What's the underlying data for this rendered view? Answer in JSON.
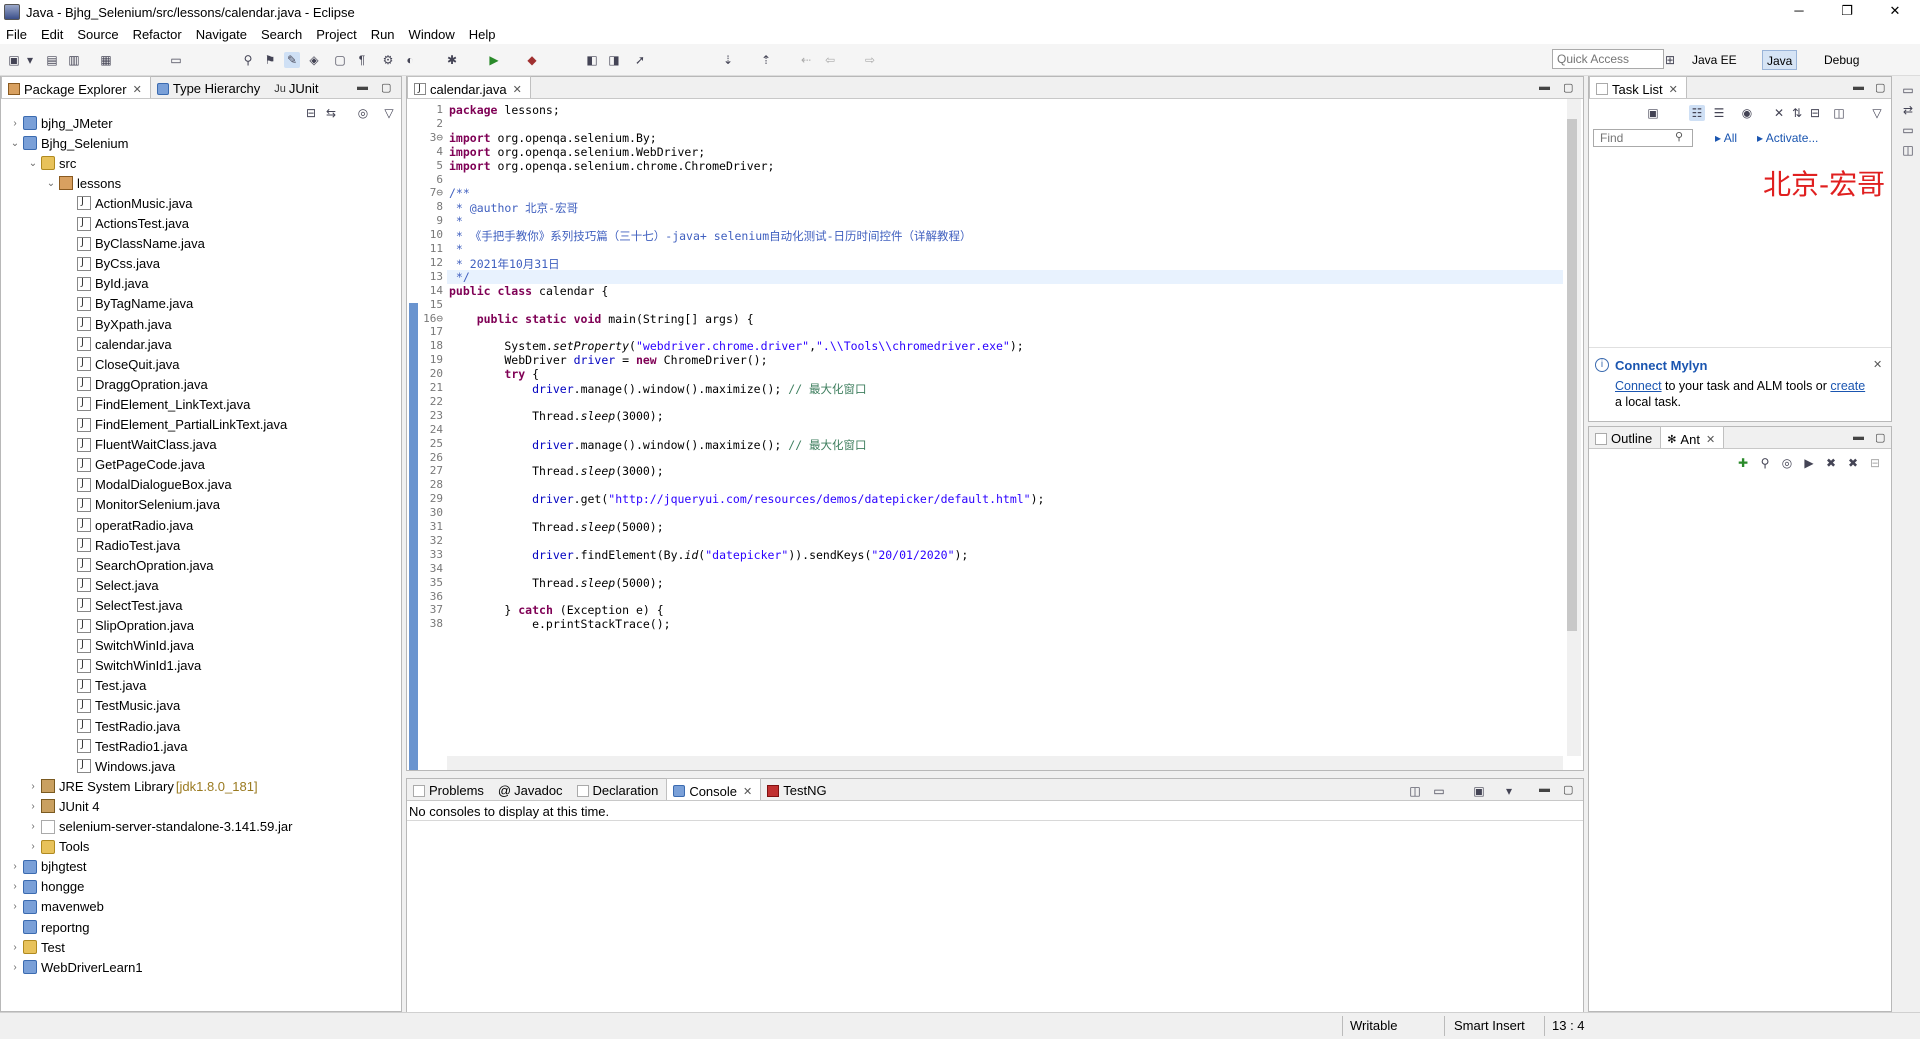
{
  "window": {
    "title": "Java - Bjhg_Selenium/src/lessons/calendar.java - Eclipse",
    "minimize": "─",
    "maximize": "❐",
    "close": "✕"
  },
  "menu": [
    "File",
    "Edit",
    "Source",
    "Refactor",
    "Navigate",
    "Search",
    "Project",
    "Run",
    "Window",
    "Help"
  ],
  "toolbar": {
    "quick_access_placeholder": "Quick Access",
    "perspectives": [
      "Java EE",
      "Java",
      "Debug"
    ],
    "active_perspective": "Java"
  },
  "left_panel": {
    "tabs": [
      "Package Explorer",
      "Type Hierarchy",
      "JUnit"
    ],
    "tree": [
      {
        "label": "bjhg_JMeter",
        "level": 0,
        "expanded": false,
        "icon": "project-icon"
      },
      {
        "label": "Bjhg_Selenium",
        "level": 0,
        "expanded": true,
        "icon": "project-icon"
      },
      {
        "label": "src",
        "level": 1,
        "expanded": true,
        "icon": "folder-icon"
      },
      {
        "label": "lessons",
        "level": 2,
        "expanded": true,
        "icon": "package-icon"
      },
      {
        "label": "ActionMusic.java",
        "level": 3,
        "icon": "java-file-icon"
      },
      {
        "label": "ActionsTest.java",
        "level": 3,
        "icon": "java-file-icon"
      },
      {
        "label": "ByClassName.java",
        "level": 3,
        "icon": "java-file-icon"
      },
      {
        "label": "ByCss.java",
        "level": 3,
        "icon": "java-file-icon"
      },
      {
        "label": "ById.java",
        "level": 3,
        "icon": "java-file-icon"
      },
      {
        "label": "ByTagName.java",
        "level": 3,
        "icon": "java-file-icon"
      },
      {
        "label": "ByXpath.java",
        "level": 3,
        "icon": "java-file-icon"
      },
      {
        "label": "calendar.java",
        "level": 3,
        "icon": "java-file-icon"
      },
      {
        "label": "CloseQuit.java",
        "level": 3,
        "icon": "java-file-icon"
      },
      {
        "label": "DraggOpration.java",
        "level": 3,
        "icon": "java-file-icon"
      },
      {
        "label": "FindElement_LinkText.java",
        "level": 3,
        "icon": "java-file-icon"
      },
      {
        "label": "FindElement_PartialLinkText.java",
        "level": 3,
        "icon": "java-file-icon"
      },
      {
        "label": "FluentWaitClass.java",
        "level": 3,
        "icon": "java-file-icon"
      },
      {
        "label": "GetPageCode.java",
        "level": 3,
        "icon": "java-file-icon"
      },
      {
        "label": "ModalDialogueBox.java",
        "level": 3,
        "icon": "java-file-icon"
      },
      {
        "label": "MonitorSelenium.java",
        "level": 3,
        "icon": "java-file-icon"
      },
      {
        "label": "operatRadio.java",
        "level": 3,
        "icon": "java-file-icon"
      },
      {
        "label": "RadioTest.java",
        "level": 3,
        "icon": "java-file-icon"
      },
      {
        "label": "SearchOpration.java",
        "level": 3,
        "icon": "java-file-icon"
      },
      {
        "label": "Select.java",
        "level": 3,
        "icon": "java-file-icon"
      },
      {
        "label": "SelectTest.java",
        "level": 3,
        "icon": "java-file-icon"
      },
      {
        "label": "SlipOpration.java",
        "level": 3,
        "icon": "java-file-icon"
      },
      {
        "label": "SwitchWinId.java",
        "level": 3,
        "icon": "java-file-icon"
      },
      {
        "label": "SwitchWinId1.java",
        "level": 3,
        "icon": "java-file-icon"
      },
      {
        "label": "Test.java",
        "level": 3,
        "icon": "java-file-icon"
      },
      {
        "label": "TestMusic.java",
        "level": 3,
        "icon": "java-file-icon"
      },
      {
        "label": "TestRadio.java",
        "level": 3,
        "icon": "java-file-icon"
      },
      {
        "label": "TestRadio1.java",
        "level": 3,
        "icon": "java-file-icon"
      },
      {
        "label": "Windows.java",
        "level": 3,
        "icon": "java-file-icon"
      },
      {
        "label": "JRE System Library",
        "meta": "[jdk1.8.0_181]",
        "level": 1,
        "expanded": false,
        "icon": "library-icon"
      },
      {
        "label": "JUnit 4",
        "level": 1,
        "expanded": false,
        "icon": "library-icon"
      },
      {
        "label": "selenium-server-standalone-3.141.59.jar",
        "level": 1,
        "expanded": false,
        "icon": "jar-icon"
      },
      {
        "label": "Tools",
        "level": 1,
        "expanded": false,
        "icon": "folder-icon"
      },
      {
        "label": "bjhgtest",
        "level": 0,
        "expanded": false,
        "icon": "project-icon"
      },
      {
        "label": "hongge",
        "level": 0,
        "expanded": false,
        "icon": "project-icon"
      },
      {
        "label": "mavenweb",
        "level": 0,
        "expanded": false,
        "icon": "project-icon"
      },
      {
        "label": "reportng",
        "level": 0,
        "icon": "project-icon"
      },
      {
        "label": "Test",
        "level": 0,
        "expanded": false,
        "icon": "folder-icon"
      },
      {
        "label": "WebDriverLearn1",
        "level": 0,
        "expanded": false,
        "icon": "project-icon"
      }
    ]
  },
  "editor": {
    "tab": "calendar.java",
    "lines": [
      {
        "n": "1",
        "html": "<span class=\"kw\">package</span> lessons;"
      },
      {
        "n": "2",
        "html": ""
      },
      {
        "n": "3⊖",
        "html": "<span class=\"kw\">import</span> org.openqa.selenium.By;"
      },
      {
        "n": "4",
        "html": "<span class=\"kw\">import</span> org.openqa.selenium.WebDriver;"
      },
      {
        "n": "5",
        "html": "<span class=\"kw\">import</span> org.openqa.selenium.chrome.ChromeDriver;"
      },
      {
        "n": "6",
        "html": ""
      },
      {
        "n": "7⊖",
        "html": "<span class=\"cmt\">/**</span>"
      },
      {
        "n": "8",
        "html": "<span class=\"cmt\"> * @author 北京-宏哥</span>"
      },
      {
        "n": "9",
        "html": "<span class=\"cmt\"> *</span>"
      },
      {
        "n": "10",
        "html": "<span class=\"cmt\"> * 《手把手教你》系列技巧篇（三十七）-java+ selenium自动化测试-日历时间控件（详解教程）</span>"
      },
      {
        "n": "11",
        "html": "<span class=\"cmt\"> *</span>"
      },
      {
        "n": "12",
        "html": "<span class=\"cmt\"> * 2021年10月31日</span>"
      },
      {
        "n": "13",
        "html": "<span class=\"cmt\"> */</span>"
      },
      {
        "n": "14",
        "html": "<span class=\"kw\">public class</span> calendar {"
      },
      {
        "n": "15",
        "html": ""
      },
      {
        "n": "16⊖",
        "html": "    <span class=\"kw\">public static void</span> main(String[] args) {"
      },
      {
        "n": "17",
        "html": ""
      },
      {
        "n": "18",
        "html": "        System.<i>setProperty</i>(<span class=\"str\">\"webdriver.chrome.driver\"</span>,<span class=\"str\">\".\\\\Tools\\\\chromedriver.exe\"</span>);"
      },
      {
        "n": "19",
        "html": "        WebDriver <span class=\"var\">driver</span> = <span class=\"kw\">new</span> ChromeDriver();"
      },
      {
        "n": "20",
        "html": "        <span class=\"kw\">try</span> {"
      },
      {
        "n": "21",
        "html": "            <span class=\"var\">driver</span>.manage().window().maximize(); <span class=\"cmt2\">// 最大化窗口</span>"
      },
      {
        "n": "22",
        "html": ""
      },
      {
        "n": "23",
        "html": "            Thread.<i>sleep</i>(3000);"
      },
      {
        "n": "24",
        "html": ""
      },
      {
        "n": "25",
        "html": "            <span class=\"var\">driver</span>.manage().window().maximize(); <span class=\"cmt2\">// 最大化窗口</span>"
      },
      {
        "n": "26",
        "html": ""
      },
      {
        "n": "27",
        "html": "            Thread.<i>sleep</i>(3000);"
      },
      {
        "n": "28",
        "html": ""
      },
      {
        "n": "29",
        "html": "            <span class=\"var\">driver</span>.get(<span class=\"str\">\"http://jqueryui.com/resources/demos/datepicker/default.html\"</span>);"
      },
      {
        "n": "30",
        "html": ""
      },
      {
        "n": "31",
        "html": "            Thread.<i>sleep</i>(5000);"
      },
      {
        "n": "32",
        "html": ""
      },
      {
        "n": "33",
        "html": "            <span class=\"var\">driver</span>.findElement(By.<i>id</i>(<span class=\"str\">\"datepicker\"</span>)).sendKeys(<span class=\"str\">\"20/01/2020\"</span>);"
      },
      {
        "n": "34",
        "html": ""
      },
      {
        "n": "35",
        "html": "            Thread.<i>sleep</i>(5000);"
      },
      {
        "n": "36",
        "html": ""
      },
      {
        "n": "37",
        "html": "        } <span class=\"kw\">catch</span> (Exception e) {"
      },
      {
        "n": "38",
        "html": "            e.printStackTrace();"
      }
    ]
  },
  "task_list": {
    "tab": "Task List",
    "find_placeholder": "Find",
    "all_label": "All",
    "activate_label": "Activate...",
    "watermark": "北京-宏哥"
  },
  "mylyn": {
    "title": "Connect Mylyn",
    "connect_link": "Connect",
    "middle_text": " to your task and ALM tools or ",
    "create_link": "create",
    "end_text": "a local task."
  },
  "outline": {
    "tabs": [
      "Outline",
      "Ant"
    ]
  },
  "console": {
    "tabs": [
      "Problems",
      "Javadoc",
      "Declaration",
      "Console",
      "TestNG"
    ],
    "message": "No consoles to display at this time."
  },
  "status": {
    "writable": "Writable",
    "insert_mode": "Smart Insert",
    "position": "13 : 4"
  }
}
